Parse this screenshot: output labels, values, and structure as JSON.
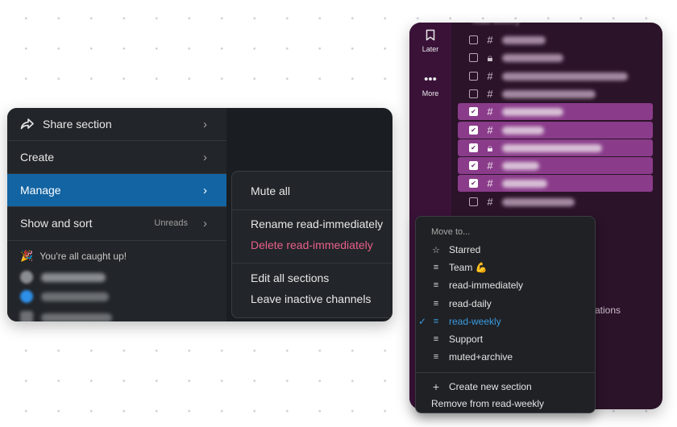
{
  "left_menu": {
    "items": [
      {
        "label": "Share section",
        "icon": "share-icon"
      },
      {
        "label": "Create"
      },
      {
        "label": "Manage",
        "active": true
      },
      {
        "label": "Show and sort",
        "hint": "Unreads"
      }
    ],
    "caught_up_emoji": "🎉",
    "caught_up_text": "You're all caught up!"
  },
  "submenu": {
    "mute_all": "Mute all",
    "rename": "Rename read-immediately",
    "delete": "Delete read-immediately",
    "edit_all": "Edit all sections",
    "leave_inactive": "Leave inactive channels"
  },
  "rail": {
    "later_label": "Later",
    "more_label": "More"
  },
  "right_panel": {
    "stray_text": "ations"
  },
  "move_menu": {
    "title": "Move to...",
    "items": [
      {
        "label": "Starred",
        "icon": "star-icon"
      },
      {
        "label": "Team 💪",
        "icon": "section-icon"
      },
      {
        "label": "read-immediately",
        "icon": "section-icon"
      },
      {
        "label": "read-daily",
        "icon": "section-icon"
      },
      {
        "label": "read-weekly",
        "icon": "section-icon",
        "current": true
      },
      {
        "label": "Support",
        "icon": "section-icon"
      },
      {
        "label": "muted+archive",
        "icon": "section-icon"
      }
    ],
    "create_new": "Create new section",
    "remove_from": "Remove from read-weekly"
  },
  "colors": {
    "active_blue": "#1264a3",
    "danger_pink": "#e8608a",
    "selected_purple": "#8a3c8a",
    "current_blue": "#3b9be0"
  }
}
